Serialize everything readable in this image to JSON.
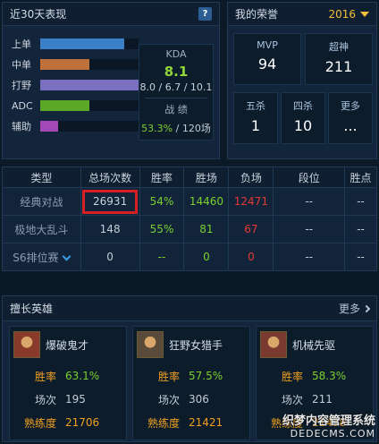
{
  "recent": {
    "title": "近30天表现",
    "help": "?",
    "roles": [
      {
        "label": "上单",
        "share": 0.85,
        "color": "#3a7fc8"
      },
      {
        "label": "中单",
        "share": 0.5,
        "color": "#c0703a"
      },
      {
        "label": "打野",
        "share": 1.0,
        "color": "#7b6fbf"
      },
      {
        "label": "ADC",
        "share": 0.5,
        "color": "#5aa825"
      },
      {
        "label": "辅助",
        "share": 0.18,
        "color": "#a548b8"
      }
    ],
    "kda_title": "KDA",
    "kda_value": "8.1",
    "kda_detail": "8.0 / 6.7 / 10.1",
    "record_title": "战 绩",
    "record_rate": "53.3%",
    "record_sep": " / ",
    "record_games": "120场"
  },
  "honor": {
    "title": "我的荣誉",
    "year": "2016",
    "mvp_label": "MVP",
    "mvp_value": "94",
    "legendary_label": "超神",
    "legendary_value": "211",
    "penta_label": "五杀",
    "penta_value": "1",
    "quadra_label": "四杀",
    "quadra_value": "10",
    "more_label": "更多",
    "more_value": "..."
  },
  "stats": {
    "headers": [
      "类型",
      "总场次数",
      "胜率",
      "胜场",
      "负场",
      "段位",
      "胜点"
    ],
    "rows": [
      {
        "type": "经典对战",
        "total": "26931",
        "rate": "54%",
        "wins": "14460",
        "losses": "12471",
        "rank": "--",
        "points": "--"
      },
      {
        "type": "极地大乱斗",
        "total": "148",
        "rate": "55%",
        "wins": "81",
        "losses": "67",
        "rank": "--",
        "points": "--"
      },
      {
        "type": "S6排位赛",
        "total": "0",
        "rate": "--",
        "wins": "0",
        "losses": "0",
        "rank": "--",
        "points": "--"
      }
    ]
  },
  "heroes": {
    "title": "擅长英雄",
    "more": "更多",
    "rate_label": "胜率",
    "games_label": "场次",
    "mastery_label": "熟练度",
    "list": [
      {
        "name": "爆破鬼才",
        "rate": "63.1%",
        "games": "195",
        "mastery": "21706",
        "portrait": "#8a3a2a"
      },
      {
        "name": "狂野女猎手",
        "rate": "57.5%",
        "games": "306",
        "mastery": "21421",
        "portrait": "#5a4a3a"
      },
      {
        "name": "机械先驱",
        "rate": "58.3%",
        "games": "211",
        "mastery": "21498",
        "portrait": "#7a3a30"
      }
    ]
  },
  "watermark": {
    "line1": "织梦内容管理系统",
    "line2": "DEDECMS.COM"
  }
}
